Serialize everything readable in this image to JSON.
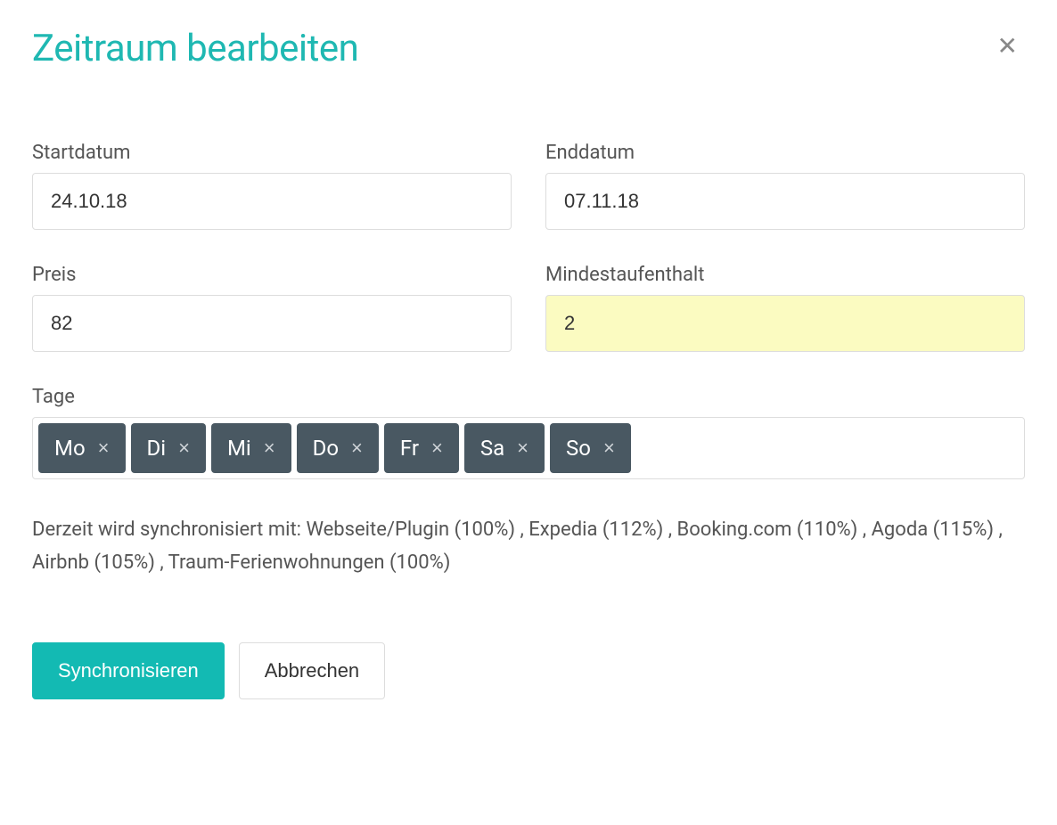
{
  "dialog": {
    "title": "Zeitraum bearbeiten"
  },
  "form": {
    "start_date_label": "Startdatum",
    "start_date_value": "24.10.18",
    "end_date_label": "Enddatum",
    "end_date_value": "07.11.18",
    "price_label": "Preis",
    "price_value": "82",
    "min_stay_label": "Mindestaufenthalt",
    "min_stay_value": "2",
    "days_label": "Tage",
    "days": [
      "Mo",
      "Di",
      "Mi",
      "Do",
      "Fr",
      "Sa",
      "So"
    ]
  },
  "sync_text": "Derzeit wird synchronisiert mit: Webseite/Plugin (100%) , Expedia (112%) , Booking.com (110%) , Agoda (115%) , Airbnb (105%) , Traum-Ferienwohnungen (100%)",
  "buttons": {
    "sync": "Synchronisieren",
    "cancel": "Abbrechen"
  }
}
